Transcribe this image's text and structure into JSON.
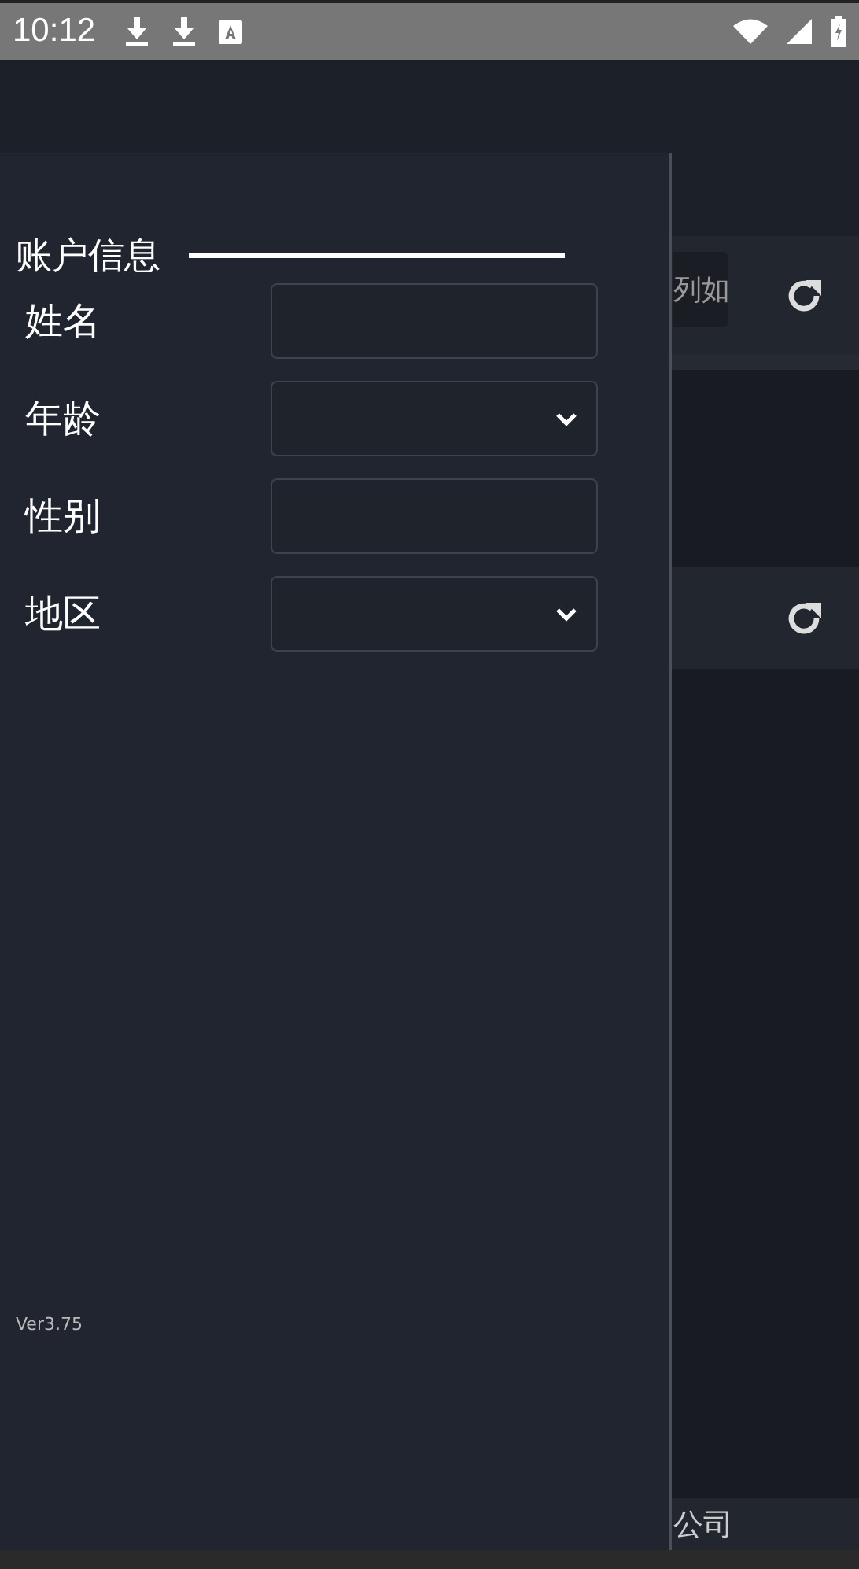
{
  "status_bar": {
    "time": "10:12"
  },
  "background_page": {
    "search_field": {
      "value": "列如"
    },
    "footer": "公司"
  },
  "drawer": {
    "title": "账户信息",
    "fields": [
      {
        "label": "姓名",
        "kind": "text"
      },
      {
        "label": "年龄",
        "kind": "select"
      },
      {
        "label": "性别",
        "kind": "text"
      },
      {
        "label": "地区",
        "kind": "select"
      }
    ],
    "version": "Ver3.75"
  }
}
